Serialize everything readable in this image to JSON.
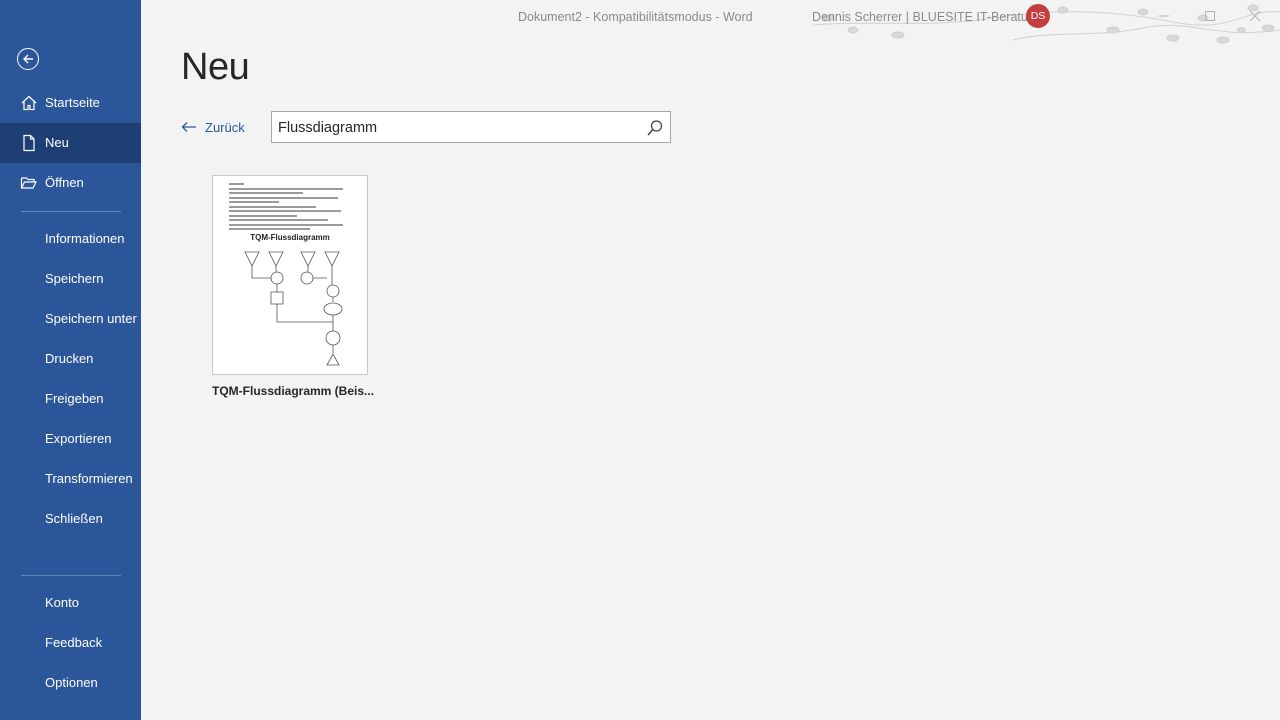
{
  "window": {
    "doc_title": "Dokument2  -  Kompatibilitätsmodus  -  Word",
    "user_name": "Dennis Scherrer | BLUESITE IT-Beratung",
    "avatar_initials": "DS"
  },
  "sidebar": {
    "top": [
      {
        "label": "Startseite",
        "icon": "home-icon"
      },
      {
        "label": "Neu",
        "icon": "new-document-icon"
      },
      {
        "label": "Öffnen",
        "icon": "folder-open-icon"
      }
    ],
    "middle": [
      "Informationen",
      "Speichern",
      "Speichern unter",
      "Drucken",
      "Freigeben",
      "Exportieren",
      "Transformieren",
      "Schließen"
    ],
    "bottom": [
      "Konto",
      "Feedback",
      "Optionen"
    ]
  },
  "main": {
    "title": "Neu",
    "back_label": "Zurück",
    "search_value": "Flussdiagramm",
    "templates": [
      {
        "caption": "TQM-Flussdiagramm (Beis...",
        "thumb_heading": "TQM-Flussdiagramm"
      }
    ]
  },
  "colors": {
    "sidebar": "#2b579a",
    "sidebar_active": "#1e3f73",
    "background": "#f3f3f3",
    "avatar": "#c43e3e"
  }
}
